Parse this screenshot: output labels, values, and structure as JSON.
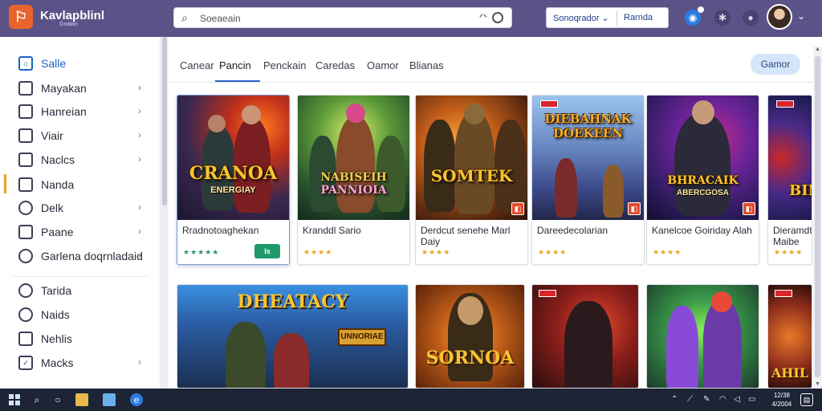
{
  "header": {
    "app_title": "Kavlapblinl",
    "app_subtitle": "Gnatan",
    "search_placeholder": "Soeaeain",
    "btn_left": "Sonoqrador",
    "btn_right": "Rarnda"
  },
  "sidebar": {
    "items": [
      {
        "label": "Salle",
        "icon": "home-icon",
        "chevron": false
      },
      {
        "label": "Mayakan",
        "icon": "monitor-icon",
        "chevron": true
      },
      {
        "label": "Hanreian",
        "icon": "laptop-icon",
        "chevron": true
      },
      {
        "label": "Viair",
        "icon": "window-icon",
        "chevron": true
      },
      {
        "label": "Naclcs",
        "icon": "box-icon",
        "chevron": true
      },
      {
        "label": "Nanda",
        "icon": "folder-icon",
        "chevron": false
      },
      {
        "label": "Delk",
        "icon": "globe-icon",
        "chevron": true
      },
      {
        "label": "Paane",
        "icon": "page-icon",
        "chevron": true
      },
      {
        "label": "Garlena doqrnladaid",
        "icon": "gear-icon",
        "chevron": true
      },
      {
        "label": "Tarida",
        "icon": "clock-icon",
        "chevron": false
      },
      {
        "label": "Naids",
        "icon": "compass-icon",
        "chevron": false
      },
      {
        "label": "Nehlis",
        "icon": "news-icon",
        "chevron": false
      },
      {
        "label": "Macks",
        "icon": "check-icon",
        "chevron": true
      }
    ]
  },
  "tabs": [
    "Canear",
    "Pancin",
    "Penckain",
    "Caredas",
    "Oamor",
    "Blianas"
  ],
  "right_button": "Gamor",
  "cards_top": [
    {
      "art_title": "CRANOA",
      "art_sub": "ENERGIAY",
      "title": "Rradnotoaghekan",
      "rating_text": "★★★★★",
      "has_get": true,
      "get_label": "Is"
    },
    {
      "art_title": "NABISEIH",
      "art_sub": "PANNIOIA",
      "title": "Kranddl Sario",
      "rating_text": "★★★★"
    },
    {
      "art_title": "SOMTEK",
      "art_sub": "",
      "title": "Derdcut senehe Marl Daiy",
      "rating_text": "★★★★"
    },
    {
      "art_title": "DIEBAHNAK",
      "art_sub": "DOEKEEN",
      "title": "Dareedecolarian",
      "rating_text": "★★★★"
    },
    {
      "art_title": "BHRACAIK",
      "art_sub": "ABERCGOSA",
      "title": "Kanelcoe Goiriday Alah",
      "rating_text": "★★★★"
    },
    {
      "art_title": "BIN",
      "art_sub": "",
      "title": "Dieramdty Maibe",
      "rating_text": "★★★★"
    }
  ],
  "cards_bottom": [
    {
      "art_title": "DHEATACY",
      "art_sub": "UNNORIAE"
    },
    {
      "art_title": "SORNOA",
      "art_sub": ""
    },
    {
      "art_title": "",
      "art_sub": ""
    },
    {
      "art_title": "",
      "art_sub": ""
    },
    {
      "art_title": "AHIL",
      "art_sub": ""
    }
  ],
  "taskbar": {
    "time": "12/38",
    "date": "4/2004"
  }
}
